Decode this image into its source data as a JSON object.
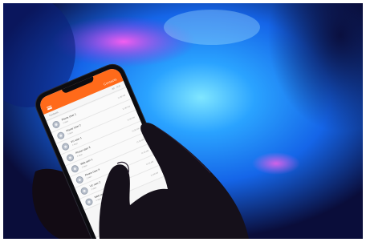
{
  "scene": {
    "description_colors": {
      "background_dark": "#0a0d3a",
      "glow_blue": "#1e88ff",
      "glow_cyan": "#5fd4ff",
      "glow_magenta": "#d63be0",
      "app_accent": "#ff6a1a"
    }
  },
  "app": {
    "title": "Contacts",
    "subbar_left": "Contacts",
    "subbar_right": [
      "All",
      "A-Z"
    ],
    "rows": [
      {
        "title": "Phone User 1",
        "sub": "2 days",
        "meta": "11:30 AM"
      },
      {
        "title": "Phone User 2",
        "sub": "2 days",
        "meta": "11:30 AM"
      },
      {
        "title": "VC user 1",
        "sub": "2 days",
        "meta": "11:30 AM"
      },
      {
        "title": "Phone User 3",
        "sub": "2 days",
        "meta": "11:30 AM"
      },
      {
        "title": "Web user 1",
        "sub": "2 days",
        "meta": "11:30 AM"
      },
      {
        "title": "Phone User 4",
        "sub": "2 days",
        "meta": "11:30 AM"
      },
      {
        "title": "VC user 2",
        "sub": "2 days",
        "meta": "11:30 AM"
      },
      {
        "title": "Web user 2",
        "sub": "2 days",
        "meta": "11:30 AM"
      }
    ],
    "tabs": [
      "calls-tab-icon",
      "contacts-tab-icon",
      "chat-tab-icon",
      "settings-tab-icon"
    ]
  }
}
